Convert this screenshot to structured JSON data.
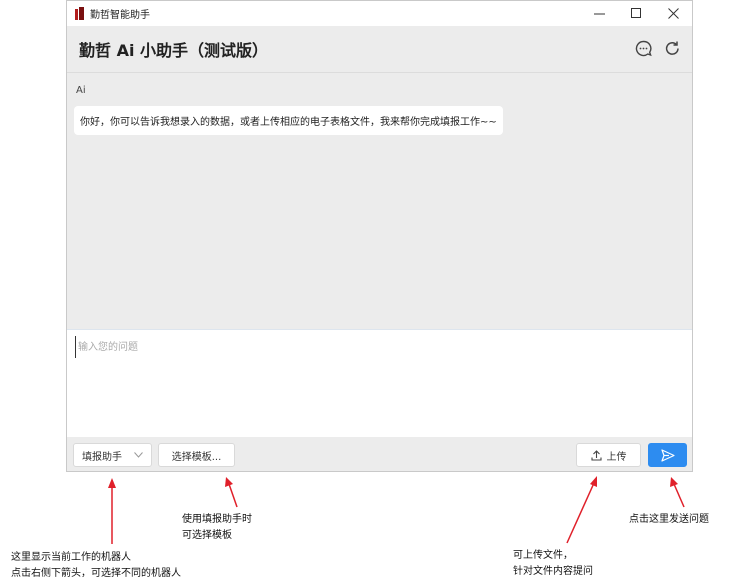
{
  "window": {
    "app_title": "勤哲智能助手",
    "controls": {
      "minimize": "—",
      "maximize": "☐",
      "close": "✕"
    }
  },
  "header": {
    "title": "勤哲 Ai 小助手（测试版）",
    "icons": [
      "chat-bubble-icon",
      "refresh-icon"
    ]
  },
  "chat": {
    "messages": [
      {
        "sender": "Ai",
        "text": "你好，你可以告诉我想录入的数据，或者上传相应的电子表格文件，我来帮你完成填报工作~~"
      }
    ]
  },
  "input": {
    "placeholder": "输入您的问题",
    "value": ""
  },
  "toolbar": {
    "assistant_select_value": "填报助手",
    "template_label": "选择模板...",
    "upload_label": "上传",
    "send_icon": "send-icon"
  },
  "annotations": {
    "assistant": {
      "line1": "这里显示当前工作的机器人",
      "line2": "点击右侧下箭头，可选择不同的机器人"
    },
    "template": {
      "line1": "使用填报助手时",
      "line2": "可选择模板"
    },
    "upload": {
      "line1": "可上传文件，",
      "line2": "针对文件内容提问"
    },
    "send": {
      "line1": "点击这里发送问题"
    }
  },
  "colors": {
    "accent": "#2d8cf0",
    "arrow": "#e0202a",
    "logo": "#b31d1d"
  }
}
